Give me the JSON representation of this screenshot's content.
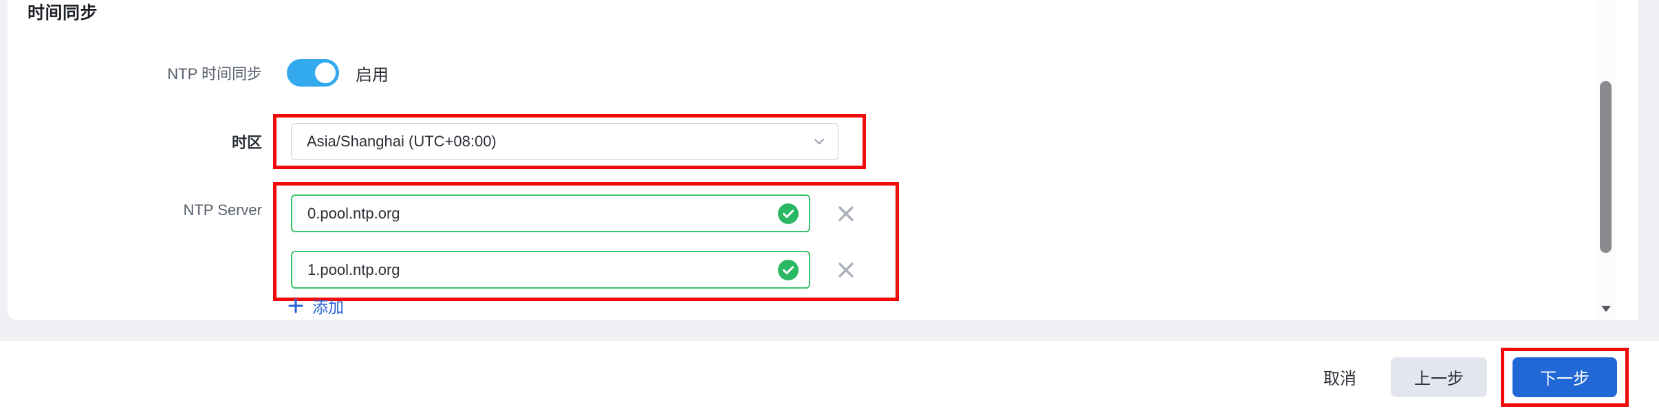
{
  "panel": {
    "section_title": "时间同步"
  },
  "form": {
    "ntp_enable": {
      "label": "NTP 时间同步",
      "toggle_state_label": "启用",
      "toggle_on": true,
      "toggle_color": "#33a9ee"
    },
    "timezone": {
      "label": "时区",
      "value": "Asia/Shanghai (UTC+08:00)",
      "chevron_icon": "chevron-down-icon",
      "highlight_color": "#f00a0a"
    },
    "ntp_servers": {
      "label": "NTP Server",
      "highlight_color": "#f00a0a",
      "valid_border_color": "#3ac26c",
      "rows": [
        {
          "value": "0.pool.ntp.org",
          "status_icon": "check-circle-icon",
          "remove_icon": "close-icon"
        },
        {
          "value": "1.pool.ntp.org",
          "status_icon": "check-circle-icon",
          "remove_icon": "close-icon"
        }
      ]
    },
    "add_link": {
      "label": "添加",
      "icon": "plus-icon",
      "color": "#2a65d8"
    }
  },
  "scrollbar": {
    "thumb_color": "#888a8d",
    "down_arrow_icon": "caret-down-icon"
  },
  "footer": {
    "cancel_label": "取消",
    "previous_label": "上一步",
    "next_label": "下一步",
    "next_color": "#2267d6",
    "previous_color": "#e3e6ed",
    "highlight_color": "#f00a0a"
  }
}
